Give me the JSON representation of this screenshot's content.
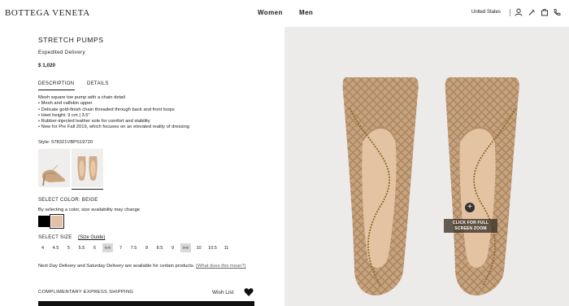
{
  "header": {
    "logo": "BOTTEGA VENETA",
    "nav": [
      "Women",
      "Men"
    ],
    "country": "United States",
    "icons": [
      "account-icon",
      "pin-icon",
      "phone-icon",
      "bag-icon"
    ]
  },
  "product": {
    "title": "STRETCH PUMPS",
    "delivery": "Expedited Delivery",
    "price": "$ 1,020",
    "tabs": [
      "DESCRIPTION",
      "DETAILS"
    ],
    "description": [
      "Mesh square toe pump with a chain detail",
      "• Mesh and calfskin upper",
      "• Delicate gold-finish chain threaded through back and front loops",
      "• Heel height: 9 cm | 3.5\"",
      "• Rubber-injected leather sole for comfort and stability",
      "• New for Pre Fall 2019, which focuses on an elevated reality of dressing"
    ],
    "style": "Style: 578321VBPS19720",
    "select_color": "SELECT COLOR: BEIGE",
    "color_note": "By selecting a color, size availability may change",
    "colors": [
      "#000000",
      "#e2c2a6"
    ],
    "select_size": "SELECT SIZE",
    "size_guide": "(Size Guide)",
    "sizes": [
      {
        "label": "4",
        "available": true
      },
      {
        "label": "4.5",
        "available": true
      },
      {
        "label": "5",
        "available": true
      },
      {
        "label": "5.5",
        "available": true
      },
      {
        "label": "6",
        "available": true
      },
      {
        "label": "6.5",
        "available": false
      },
      {
        "label": "7",
        "available": true
      },
      {
        "label": "7.5",
        "available": true
      },
      {
        "label": "8",
        "available": true
      },
      {
        "label": "8.5",
        "available": true
      },
      {
        "label": "9",
        "available": true
      },
      {
        "label": "9.5",
        "available": false
      },
      {
        "label": "10",
        "available": true
      },
      {
        "label": "10.5",
        "available": true
      },
      {
        "label": "11",
        "available": true
      }
    ],
    "nextday_text": "Next Day Delivery and Saturday Delivery are available for certain products.",
    "nextday_link": "(What does this mean?)",
    "shipping": "COMPLIMENTARY EXPRESS SHIPPING",
    "wishlist": "Wish List"
  },
  "zoom": {
    "icon": "+",
    "text": "CLICK FOR FULL SCREEN ZOOM"
  }
}
